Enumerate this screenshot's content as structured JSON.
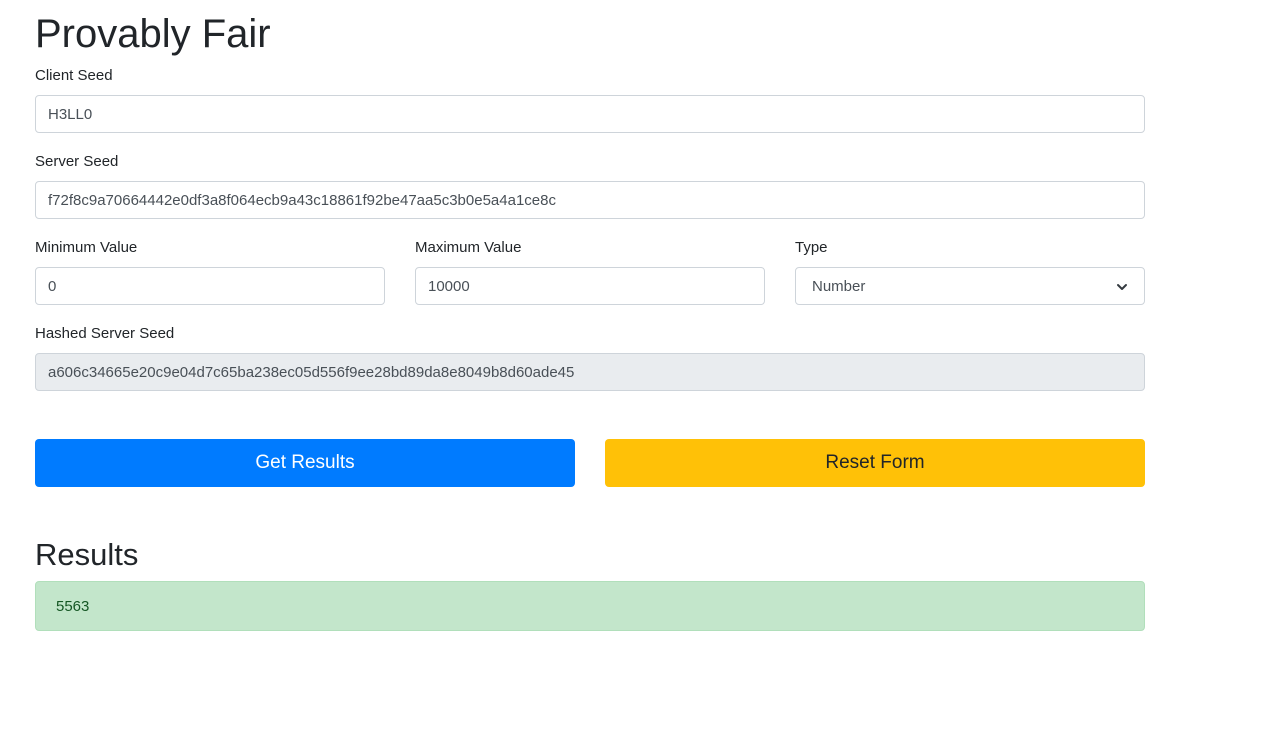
{
  "page": {
    "title": "Provably Fair"
  },
  "form": {
    "client_seed": {
      "label": "Client Seed",
      "value": "H3LL0"
    },
    "server_seed": {
      "label": "Server Seed",
      "value": "f72f8c9a70664442e0df3a8f064ecb9a43c18861f92be47aa5c3b0e5a4a1ce8c"
    },
    "minimum_value": {
      "label": "Minimum Value",
      "value": "0"
    },
    "maximum_value": {
      "label": "Maximum Value",
      "value": "10000"
    },
    "type": {
      "label": "Type",
      "selected": "Number"
    },
    "hashed_server_seed": {
      "label": "Hashed Server Seed",
      "value": "a606c34665e20c9e04d7c65ba238ec05d556f9ee28bd89da8e8049b8d60ade45"
    }
  },
  "actions": {
    "get_results_label": "Get Results",
    "reset_form_label": "Reset Form"
  },
  "results": {
    "title": "Results",
    "value": "5563"
  },
  "colors": {
    "primary": "#007bff",
    "warning": "#ffc107",
    "success_bg": "#c3e6cb",
    "readonly_bg": "#e9ecef"
  },
  "icons": {
    "type_select": "chevron-down-icon"
  }
}
